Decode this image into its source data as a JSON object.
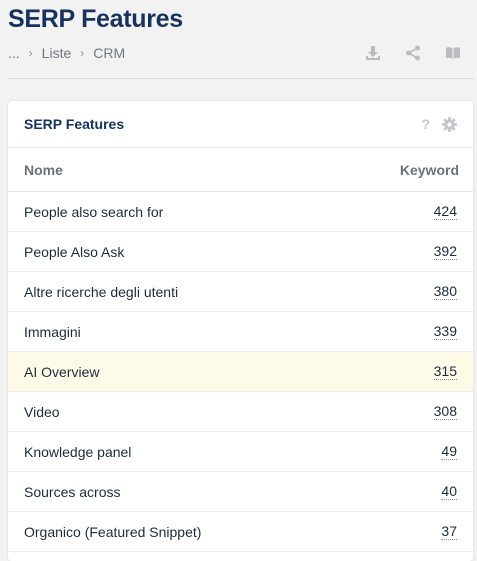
{
  "page": {
    "title": "SERP Features"
  },
  "breadcrumb": {
    "items": [
      "...",
      "Liste",
      "CRM"
    ]
  },
  "toolbar": {
    "icons": [
      "download-icon",
      "share-icon",
      "book-icon"
    ]
  },
  "card": {
    "title": "SERP Features",
    "help": "?",
    "columns": {
      "name": "Nome",
      "keyword": "Keyword"
    },
    "rows": [
      {
        "name": "People also search for",
        "value": "424"
      },
      {
        "name": "People Also Ask",
        "value": "392"
      },
      {
        "name": "Altre ricerche degli utenti",
        "value": "380"
      },
      {
        "name": "Immagini",
        "value": "339"
      },
      {
        "name": "AI Overview",
        "value": "315"
      },
      {
        "name": "Video",
        "value": "308"
      },
      {
        "name": "Knowledge panel",
        "value": "49"
      },
      {
        "name": "Sources across",
        "value": "40"
      },
      {
        "name": "Organico (Featured Snippet)",
        "value": "37"
      }
    ]
  }
}
